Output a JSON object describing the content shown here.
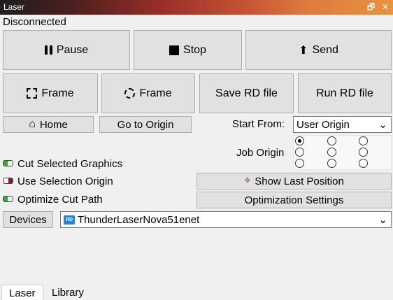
{
  "window": {
    "title": "Laser",
    "restore_icon": "restore-icon",
    "close_icon": "close-icon",
    "restore_glyph": "🗗",
    "close_glyph": "✕"
  },
  "status": "Disconnected",
  "buttons": {
    "pause": "Pause",
    "stop": "Stop",
    "send": "Send",
    "frame_rect": "Frame",
    "frame_circle": "Frame",
    "save_rd": "Save RD file",
    "run_rd": "Run RD file",
    "home": "Home",
    "go_origin": "Go to Origin",
    "show_last": "Show Last Position",
    "opt_settings": "Optimization Settings",
    "devices": "Devices"
  },
  "icons": {
    "send_glyph": "⬆",
    "home_glyph": "⌂",
    "crosshair_glyph": "⌖",
    "dropdown_glyph": "⌄"
  },
  "start_from": {
    "label": "Start From:",
    "value": "User Origin"
  },
  "job_origin": {
    "label": "Job Origin",
    "selected": [
      0,
      0
    ]
  },
  "options": [
    {
      "label": "Cut Selected Graphics",
      "state": "on",
      "color": "#2db02d"
    },
    {
      "label": "Use Selection Origin",
      "state": "off",
      "color": "#8b1d1d"
    },
    {
      "label": "Optimize Cut Path",
      "state": "on",
      "color": "#2db02d"
    }
  ],
  "device": {
    "name": "ThunderLaserNova51enet",
    "logo_text": "RD",
    "accent": "#2b7de1"
  },
  "tabs": [
    "Laser",
    "Library"
  ]
}
